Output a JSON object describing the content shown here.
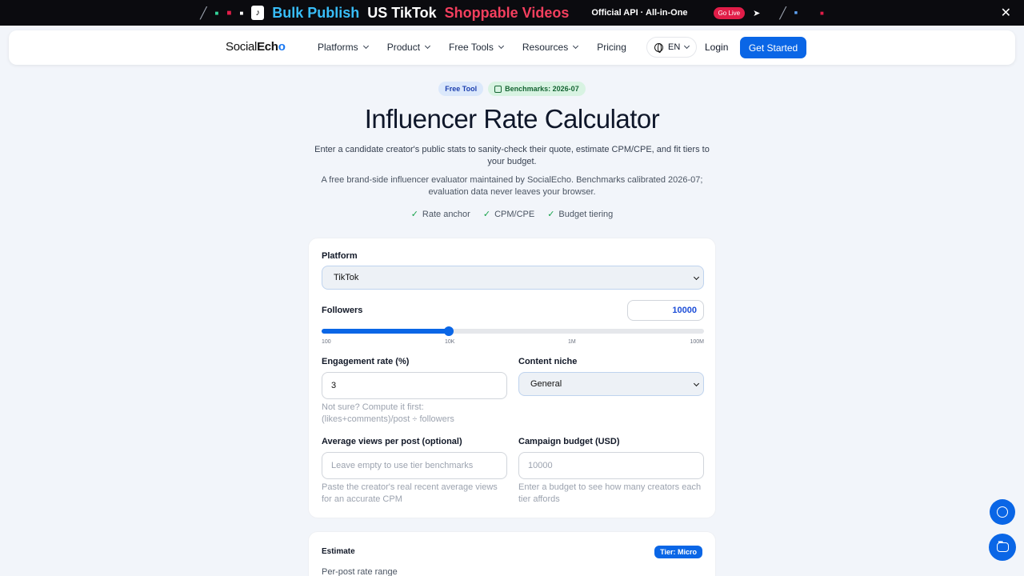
{
  "banner": {
    "part1": "Bulk Publish",
    "part2": "US TikTok",
    "part3": "Shoppable Videos",
    "api": "Official API · All-in-One",
    "golive": "Go Live"
  },
  "nav": {
    "logo_a": "Social",
    "logo_b": "Ech",
    "logo_c": "o",
    "items": [
      "Platforms",
      "Product",
      "Free Tools",
      "Resources",
      "Pricing"
    ],
    "lang": "EN",
    "login": "Login",
    "cta": "Get Started"
  },
  "hero": {
    "badge_free": "Free Tool",
    "badge_bench": "Benchmarks: 2026-07",
    "title": "Influencer Rate Calculator",
    "subtitle": "Enter a candidate creator's public stats to sanity-check their quote, estimate CPM/CPE, and fit tiers to your budget.",
    "note": "A free brand-side influencer evaluator maintained by SocialEcho. Benchmarks calibrated 2026-07; evaluation data never leaves your browser.",
    "checks": [
      "Rate anchor",
      "CPM/CPE",
      "Budget tiering"
    ]
  },
  "form": {
    "platform_label": "Platform",
    "platform_value": "TikTok",
    "followers_label": "Followers",
    "followers_value": "10000",
    "slider_fraction": 0.333,
    "slider_ticks": [
      "100",
      "10K",
      "1M",
      "100M"
    ],
    "engagement_label": "Engagement rate (%)",
    "engagement_value": "3",
    "engagement_hint": "Not sure? Compute it first: (likes+comments)/post ÷ followers",
    "niche_label": "Content niche",
    "niche_value": "General",
    "views_label": "Average views per post (optional)",
    "views_placeholder": "Leave empty to use tier benchmarks",
    "views_hint": "Paste the creator's real recent average views for an accurate CPM",
    "budget_label": "Campaign budget (USD)",
    "budget_placeholder": "10000",
    "budget_hint": "Enter a budget to see how many creators each tier affords"
  },
  "estimate": {
    "title": "Estimate",
    "tier": "Tier: Micro",
    "range_label": "Per-post rate range"
  },
  "colors": {
    "primary": "#0a66e6",
    "banner_bg": "#0b0b0f",
    "banner_blue": "#38bdf8",
    "banner_red": "#f43f5e"
  }
}
